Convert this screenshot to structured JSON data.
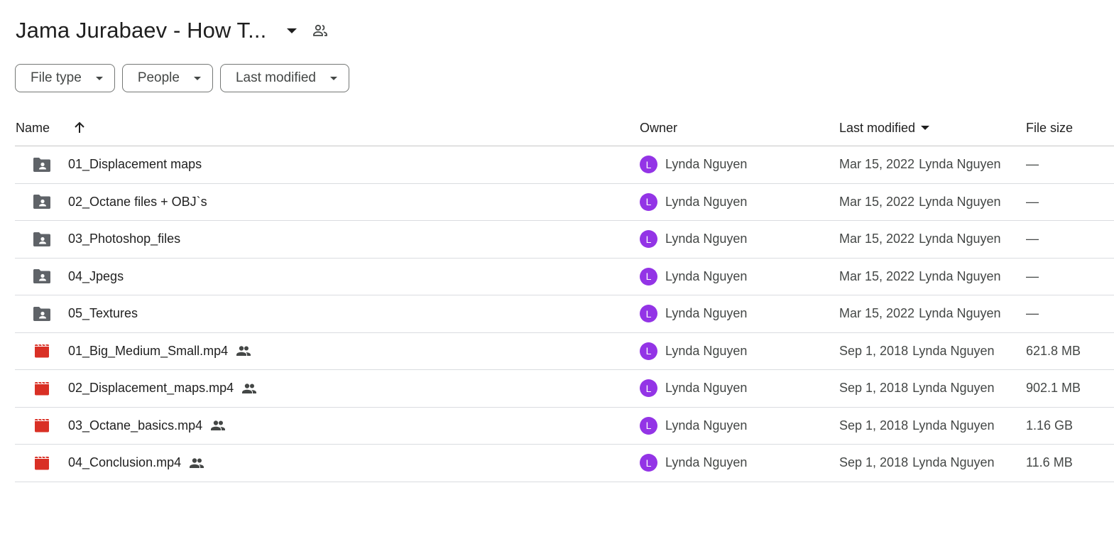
{
  "header": {
    "title": "Jama Jurabaev - How T..."
  },
  "filters": [
    {
      "label": "File type"
    },
    {
      "label": "People"
    },
    {
      "label": "Last modified"
    }
  ],
  "columns": {
    "name": "Name",
    "owner": "Owner",
    "last_modified": "Last modified",
    "file_size": "File size"
  },
  "colors": {
    "avatar": "#9334e6",
    "folder_icon": "#5f6368",
    "video_icon": "#d93025"
  },
  "rows": [
    {
      "type": "folder-shared-icon",
      "name": "01_Displacement maps",
      "shared": false,
      "owner_initial": "L",
      "owner": "Lynda Nguyen",
      "modified_date": "Mar 15, 2022",
      "modified_by": "Lynda Nguyen",
      "size": "—"
    },
    {
      "type": "folder-shared-icon",
      "name": "02_Octane files + OBJ`s",
      "shared": false,
      "owner_initial": "L",
      "owner": "Lynda Nguyen",
      "modified_date": "Mar 15, 2022",
      "modified_by": "Lynda Nguyen",
      "size": "—"
    },
    {
      "type": "folder-shared-icon",
      "name": "03_Photoshop_files",
      "shared": false,
      "owner_initial": "L",
      "owner": "Lynda Nguyen",
      "modified_date": "Mar 15, 2022",
      "modified_by": "Lynda Nguyen",
      "size": "—"
    },
    {
      "type": "folder-shared-icon",
      "name": "04_Jpegs",
      "shared": false,
      "owner_initial": "L",
      "owner": "Lynda Nguyen",
      "modified_date": "Mar 15, 2022",
      "modified_by": "Lynda Nguyen",
      "size": "—"
    },
    {
      "type": "folder-shared-icon",
      "name": "05_Textures",
      "shared": false,
      "owner_initial": "L",
      "owner": "Lynda Nguyen",
      "modified_date": "Mar 15, 2022",
      "modified_by": "Lynda Nguyen",
      "size": "—"
    },
    {
      "type": "video-file-icon",
      "name": "01_Big_Medium_Small.mp4",
      "shared": true,
      "owner_initial": "L",
      "owner": "Lynda Nguyen",
      "modified_date": "Sep 1, 2018",
      "modified_by": "Lynda Nguyen",
      "size": "621.8 MB"
    },
    {
      "type": "video-file-icon",
      "name": "02_Displacement_maps.mp4",
      "shared": true,
      "owner_initial": "L",
      "owner": "Lynda Nguyen",
      "modified_date": "Sep 1, 2018",
      "modified_by": "Lynda Nguyen",
      "size": "902.1 MB"
    },
    {
      "type": "video-file-icon",
      "name": "03_Octane_basics.mp4",
      "shared": true,
      "owner_initial": "L",
      "owner": "Lynda Nguyen",
      "modified_date": "Sep 1, 2018",
      "modified_by": "Lynda Nguyen",
      "size": "1.16 GB"
    },
    {
      "type": "video-file-icon",
      "name": "04_Conclusion.mp4",
      "shared": true,
      "owner_initial": "L",
      "owner": "Lynda Nguyen",
      "modified_date": "Sep 1, 2018",
      "modified_by": "Lynda Nguyen",
      "size": "11.6 MB"
    }
  ]
}
